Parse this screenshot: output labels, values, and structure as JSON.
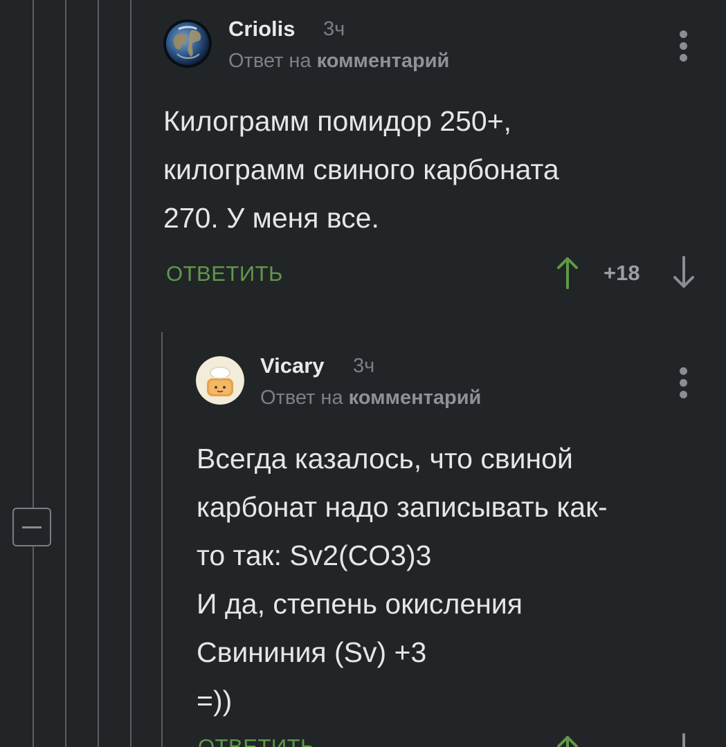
{
  "comments": [
    {
      "author": "Criolis",
      "time": "3ч",
      "reply_prefix": "Ответ на",
      "reply_target": "комментарий",
      "text": "Килограмм помидор 250+,\nкилограмм свиного карбоната\n270. У меня все.",
      "reply_label": "ОТВЕТИТЬ",
      "rating": "+18",
      "avatar_icon": "earth-globe-avatar",
      "vote_up_icon": "arrow-up-icon",
      "vote_down_icon": "arrow-down-icon"
    },
    {
      "author": "Vicary",
      "time": "3ч",
      "reply_prefix": "Ответ на",
      "reply_target": "комментарий",
      "text": "Всегда казалось, что свиной\nкарбонат надо записывать как-\nто так: Sv2(CO3)3\nИ да, степень окисления\nСвининия (Sv) +3\n=))",
      "reply_label": "ОТВЕТИТЬ",
      "avatar_icon": "chef-toast-avatar",
      "vote_up_icon": "arrow-up-icon",
      "vote_down_icon": "arrow-down-icon"
    }
  ],
  "colors": {
    "background": "#222528",
    "accent_green": "#5f9a47",
    "muted_text": "#7c8085",
    "body_text": "#e6e6e6"
  }
}
